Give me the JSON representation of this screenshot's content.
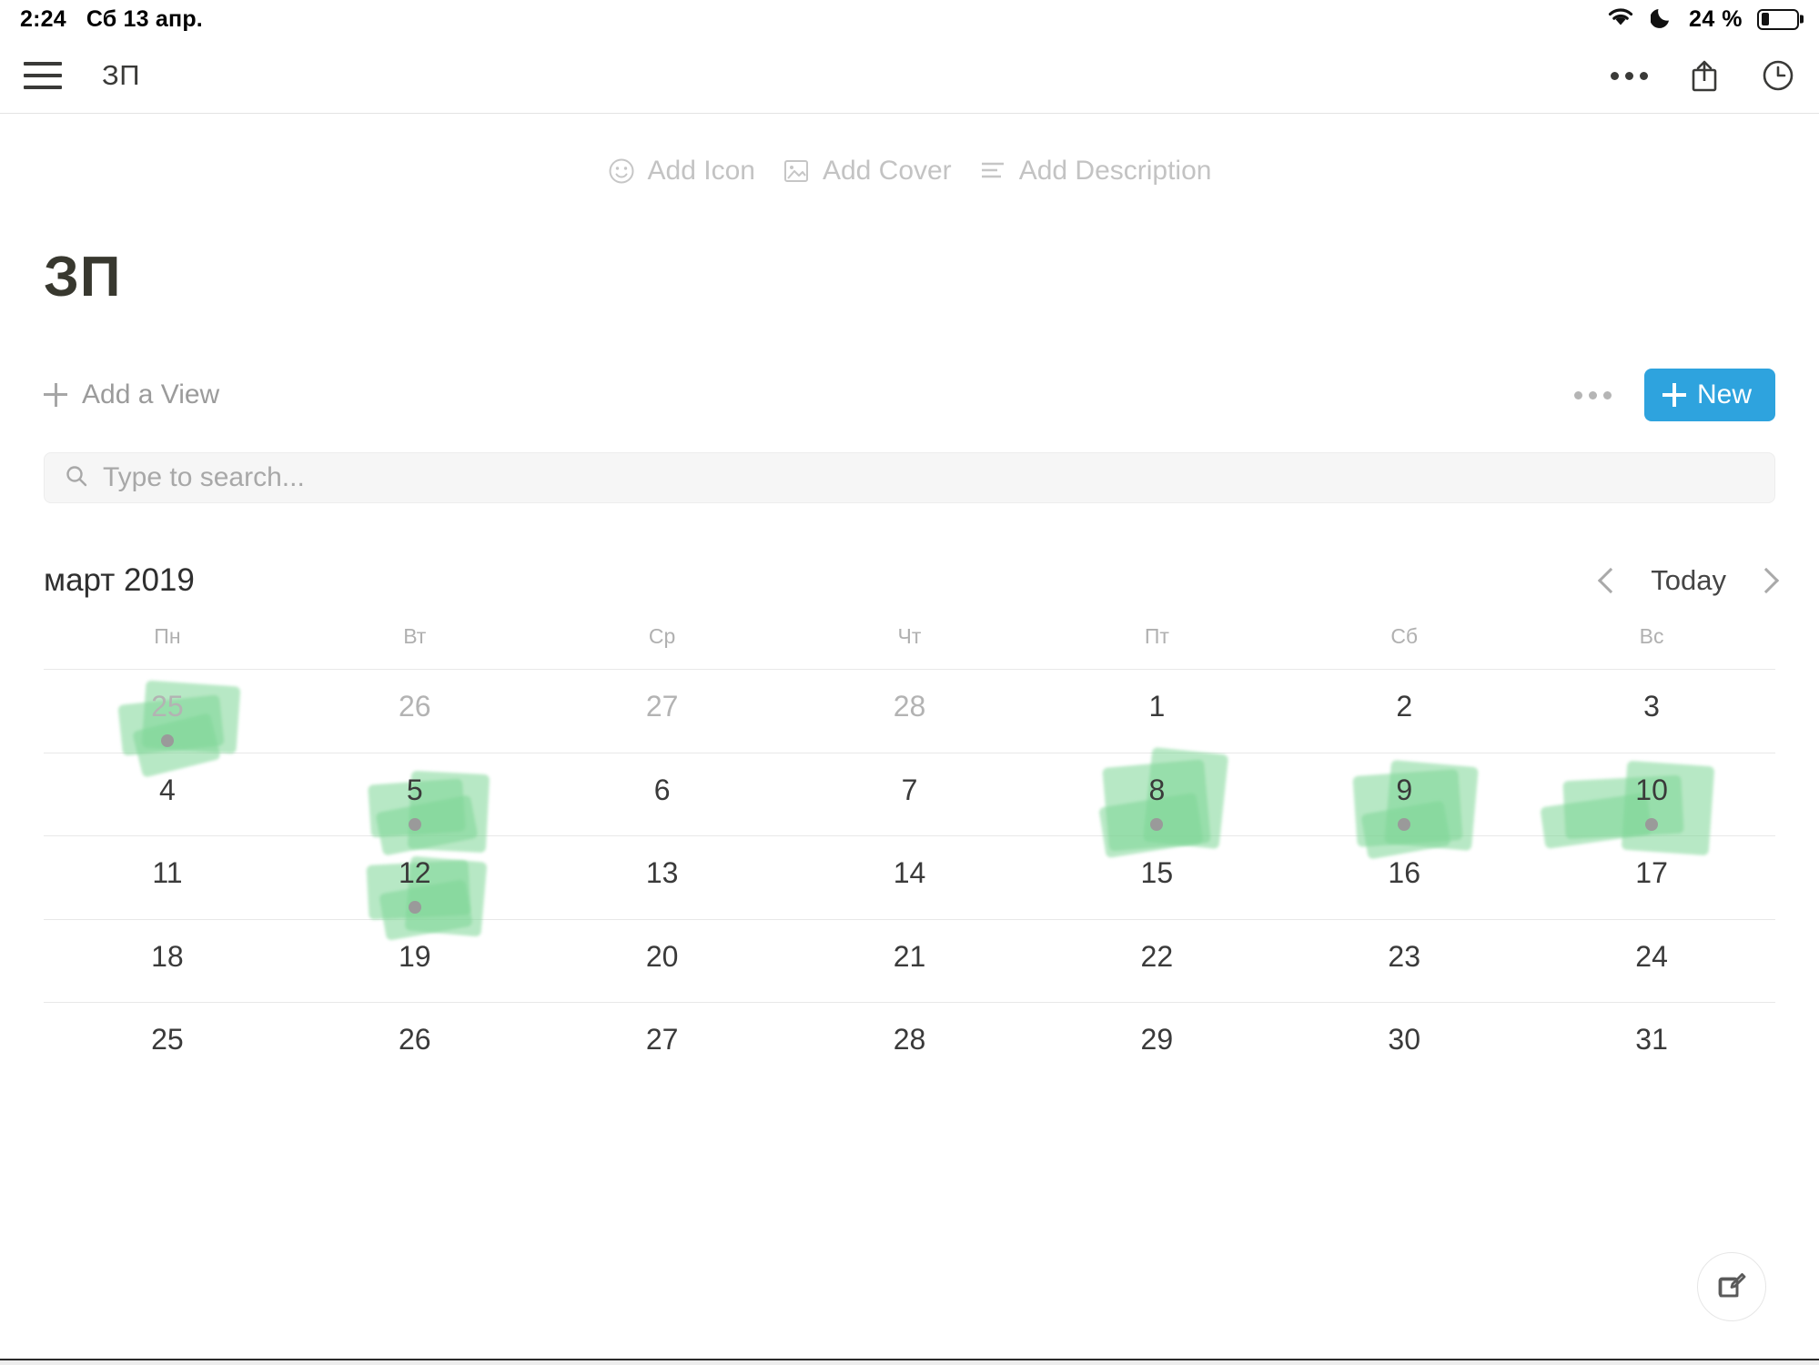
{
  "status_bar": {
    "time": "2:24",
    "date": "Сб 13 апр.",
    "battery_percent": "24 %",
    "battery_level": 24,
    "wifi_icon": "wifi-icon",
    "dnd_icon": "moon-icon"
  },
  "nav": {
    "title": "ЗП",
    "menu_icon": "hamburger-icon",
    "more_icon": "ellipsis-icon",
    "share_icon": "share-icon",
    "history_icon": "clock-icon"
  },
  "page_actions": {
    "add_icon": "Add Icon",
    "add_cover": "Add Cover",
    "add_description": "Add Description"
  },
  "page": {
    "title": "ЗП"
  },
  "view_bar": {
    "add_view": "Add a View",
    "more": "ellipsis-icon",
    "new_button": "New"
  },
  "search": {
    "placeholder": "Type to search...",
    "value": "",
    "icon": "search-icon"
  },
  "calendar": {
    "month_label": "март 2019",
    "today_label": "Today",
    "prev_icon": "chevron-left-icon",
    "next_icon": "chevron-right-icon",
    "weekdays": [
      "Пн",
      "Вт",
      "Ср",
      "Чт",
      "Пт",
      "Сб",
      "Вс"
    ],
    "accent_color": "#7ed696",
    "weeks": [
      [
        {
          "day": "25",
          "muted": true,
          "dot": true,
          "marked": true
        },
        {
          "day": "26",
          "muted": true,
          "dot": false,
          "marked": false
        },
        {
          "day": "27",
          "muted": true,
          "dot": false,
          "marked": false
        },
        {
          "day": "28",
          "muted": true,
          "dot": false,
          "marked": false
        },
        {
          "day": "1",
          "muted": false,
          "dot": false,
          "marked": false
        },
        {
          "day": "2",
          "muted": false,
          "dot": false,
          "marked": false
        },
        {
          "day": "3",
          "muted": false,
          "dot": false,
          "marked": false
        }
      ],
      [
        {
          "day": "4",
          "muted": false,
          "dot": false,
          "marked": false
        },
        {
          "day": "5",
          "muted": false,
          "dot": true,
          "marked": true
        },
        {
          "day": "6",
          "muted": false,
          "dot": false,
          "marked": false
        },
        {
          "day": "7",
          "muted": false,
          "dot": false,
          "marked": false
        },
        {
          "day": "8",
          "muted": false,
          "dot": true,
          "marked": true
        },
        {
          "day": "9",
          "muted": false,
          "dot": true,
          "marked": true
        },
        {
          "day": "10",
          "muted": false,
          "dot": true,
          "marked": true
        }
      ],
      [
        {
          "day": "11",
          "muted": false,
          "dot": false,
          "marked": false
        },
        {
          "day": "12",
          "muted": false,
          "dot": true,
          "marked": true
        },
        {
          "day": "13",
          "muted": false,
          "dot": false,
          "marked": false
        },
        {
          "day": "14",
          "muted": false,
          "dot": false,
          "marked": false
        },
        {
          "day": "15",
          "muted": false,
          "dot": false,
          "marked": false
        },
        {
          "day": "16",
          "muted": false,
          "dot": false,
          "marked": false
        },
        {
          "day": "17",
          "muted": false,
          "dot": false,
          "marked": false
        }
      ],
      [
        {
          "day": "18",
          "muted": false,
          "dot": false,
          "marked": false
        },
        {
          "day": "19",
          "muted": false,
          "dot": false,
          "marked": false
        },
        {
          "day": "20",
          "muted": false,
          "dot": false,
          "marked": false
        },
        {
          "day": "21",
          "muted": false,
          "dot": false,
          "marked": false
        },
        {
          "day": "22",
          "muted": false,
          "dot": false,
          "marked": false
        },
        {
          "day": "23",
          "muted": false,
          "dot": false,
          "marked": false
        },
        {
          "day": "24",
          "muted": false,
          "dot": false,
          "marked": false
        }
      ],
      [
        {
          "day": "25",
          "muted": false,
          "dot": false,
          "marked": false
        },
        {
          "day": "26",
          "muted": false,
          "dot": false,
          "marked": false
        },
        {
          "day": "27",
          "muted": false,
          "dot": false,
          "marked": false
        },
        {
          "day": "28",
          "muted": false,
          "dot": false,
          "marked": false
        },
        {
          "day": "29",
          "muted": false,
          "dot": false,
          "marked": false
        },
        {
          "day": "30",
          "muted": false,
          "dot": false,
          "marked": false
        },
        {
          "day": "31",
          "muted": false,
          "dot": false,
          "marked": false
        }
      ]
    ]
  },
  "fab": {
    "icon": "compose-icon"
  }
}
